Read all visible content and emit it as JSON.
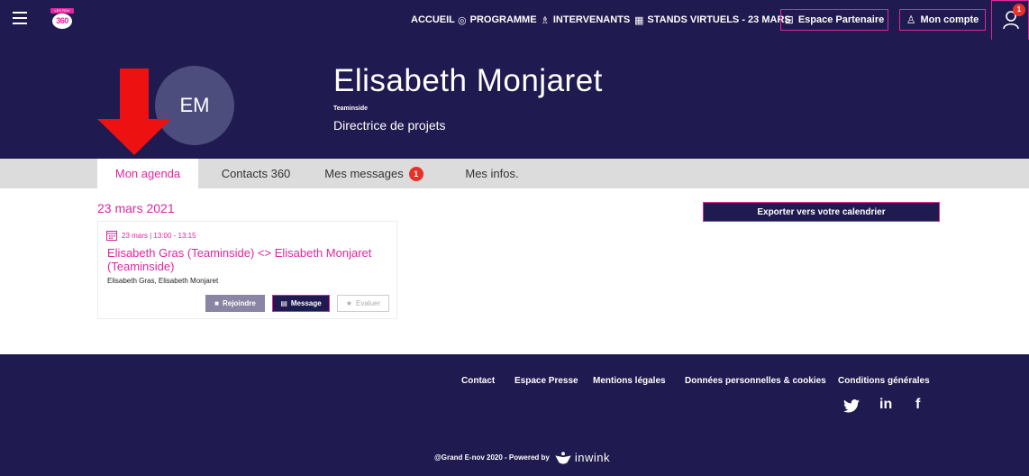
{
  "header": {
    "logo": {
      "tag": "LES RDV",
      "number": "360"
    },
    "nav": [
      {
        "icon": "",
        "label": "ACCUEIL"
      },
      {
        "icon": "◎",
        "label": "PROGRAMME"
      },
      {
        "icon": "♗",
        "label": "INTERVENANTS"
      },
      {
        "icon": "▦",
        "label": "STANDS VIRTUELS - 23 MARS"
      }
    ],
    "partner_label": "Espace Partenaire",
    "account_label": "Mon compte",
    "user_badge": "1"
  },
  "profile": {
    "initials": "EM",
    "name": "Elisabeth Monjaret",
    "company": "Teaminside",
    "job_title": "Directrice de projets"
  },
  "tabs": [
    {
      "label": "Mon agenda",
      "active": true
    },
    {
      "label": "Contacts 360"
    },
    {
      "label": "Mes messages",
      "badge": "1"
    },
    {
      "label": "Mes infos."
    }
  ],
  "agenda": {
    "date_heading": "23 mars 2021",
    "export_label": "Exporter vers votre calendrier",
    "event": {
      "time": "23 mars | 13:00 - 13:15",
      "title": "Elisabeth Gras (Teaminside) <> Elisabeth Monjaret (Teaminside)",
      "participants": "Elisabeth Gras, Elisabeth Monjaret",
      "join_label": "Rejoindre",
      "message_label": "Message",
      "evaluate_label": "Evaluer"
    }
  },
  "footer": {
    "links": [
      "Contact",
      "Espace Presse",
      "Mentions légales",
      "Données personnelles & cookies",
      "Conditions générales"
    ],
    "social": {
      "twitter": "",
      "linkedin": "in",
      "facebook": "f"
    },
    "powered_text": "@Grand E-nov 2020 - Powered by",
    "brand": "inwink"
  },
  "colors": {
    "navy": "#1f1a4f",
    "magenta": "#e0269f",
    "badge": "#e6312a",
    "arrow": "#ee1111"
  }
}
